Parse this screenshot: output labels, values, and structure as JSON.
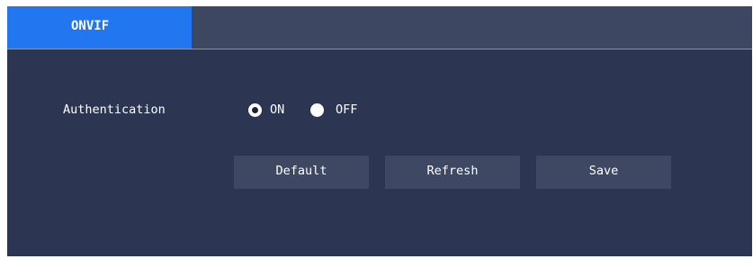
{
  "tabs": {
    "active_label": "ONVIF"
  },
  "form": {
    "authentication_label": "Authentication",
    "on_label": "ON",
    "off_label": "OFF",
    "selected": "ON"
  },
  "buttons": {
    "default_label": "Default",
    "refresh_label": "Refresh",
    "save_label": "Save"
  },
  "colors": {
    "panel_bg": "#2c3551",
    "tabbar_bg": "#3e4761",
    "active_tab": "#2277f0",
    "button_bg": "#3e4863"
  }
}
